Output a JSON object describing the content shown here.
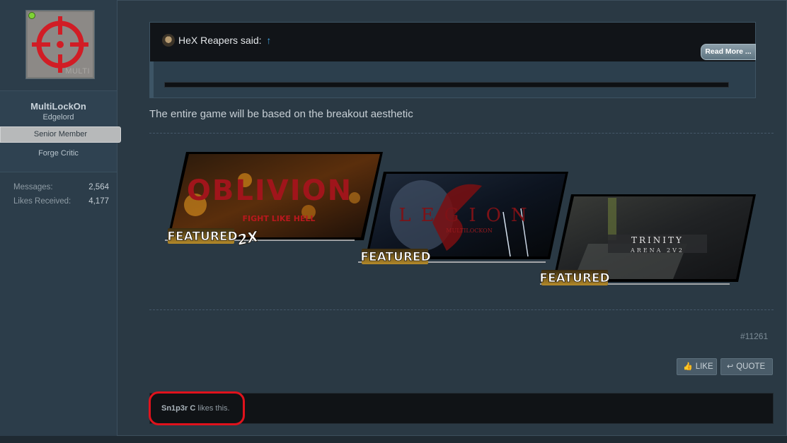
{
  "sidebar": {
    "avatar_text": "MULTI",
    "username": "MultiLockOn",
    "user_title": "Edgelord",
    "rank_banner": "Senior Member",
    "extra_title": "Forge Critic",
    "stats": [
      {
        "label": "Messages:",
        "value": "2,564"
      },
      {
        "label": "Likes Received:",
        "value": "4,177"
      }
    ]
  },
  "quote": {
    "author": "HeX Reapers said:",
    "arrow": "↑",
    "read_more": "Read More ..."
  },
  "post": {
    "text": "The entire game will be based on the breakout aesthetic",
    "number": "#11261"
  },
  "banners": [
    {
      "title": "OBLIVION",
      "subtitle": "FIGHT LIKE HELL",
      "badge": "FEATURED",
      "badge_extra": "2X"
    },
    {
      "title": "LEGION",
      "subtitle": "MULTILOCKON",
      "badge": "FEATURED",
      "badge_extra": ""
    },
    {
      "title": "TRINITY",
      "subtitle": "ARENA 2V2",
      "badge": "FEATURED",
      "badge_extra": ""
    }
  ],
  "actions": {
    "like": "LIKE",
    "quote": "QUOTE"
  },
  "likes": {
    "user": "Sn1p3r C",
    "suffix": " likes this."
  },
  "colors": {
    "highlight": "#e0121c",
    "online": "#7fd335",
    "quote_arrow": "#3fa3e0"
  }
}
